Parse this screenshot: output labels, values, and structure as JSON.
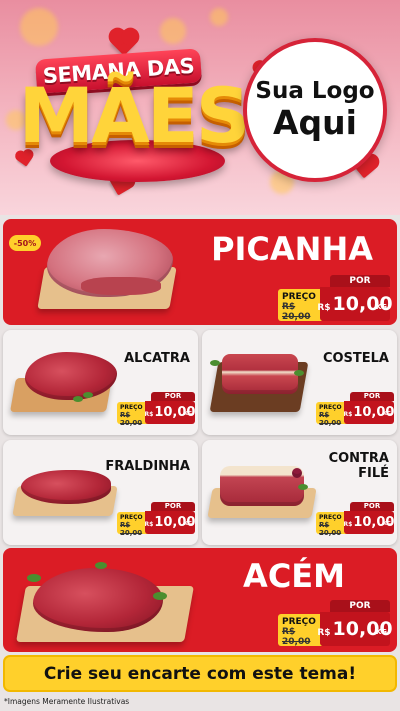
{
  "header": {
    "title_small": "SEMANA DAS",
    "title_big": "MÃES",
    "logo_line1": "Sua Logo",
    "logo_line2": "Aqui"
  },
  "colors": {
    "primary_red": "#db1c25",
    "yellow": "#ffd02b",
    "header_pink": "#f4b7c2"
  },
  "products": [
    {
      "name": "PICANHA",
      "discount_badge": "-50%",
      "por_label": "POR",
      "preco_label": "PREÇO",
      "old_price": "R$ 20,00",
      "currency": "R$",
      "price": "10,00",
      "unit": "KG"
    },
    {
      "name": "ALCATRA",
      "por_label": "POR",
      "preco_label": "PREÇO",
      "old_price": "R$ 20,00",
      "currency": "R$",
      "price": "10,00",
      "unit": "KG"
    },
    {
      "name": "COSTELA",
      "por_label": "POR",
      "preco_label": "PREÇO",
      "old_price": "R$ 20,00",
      "currency": "R$",
      "price": "10,00",
      "unit": "KG"
    },
    {
      "name": "FRALDINHA",
      "por_label": "POR",
      "preco_label": "PREÇO",
      "old_price": "R$ 20,00",
      "currency": "R$",
      "price": "10,00",
      "unit": "KG"
    },
    {
      "name_line1": "CONTRA",
      "name_line2": "FILÉ",
      "por_label": "POR",
      "preco_label": "PREÇO",
      "old_price": "R$ 20,00",
      "currency": "R$",
      "price": "10,00",
      "unit": "KG"
    },
    {
      "name": "ACÉM",
      "por_label": "POR",
      "preco_label": "PREÇO",
      "old_price": "R$ 20,00",
      "currency": "R$",
      "price": "10,00",
      "unit": "KG"
    }
  ],
  "banner": {
    "text": "Crie seu encarte com este tema!"
  },
  "footnote": "*Imagens Meramente Ilustrativas"
}
